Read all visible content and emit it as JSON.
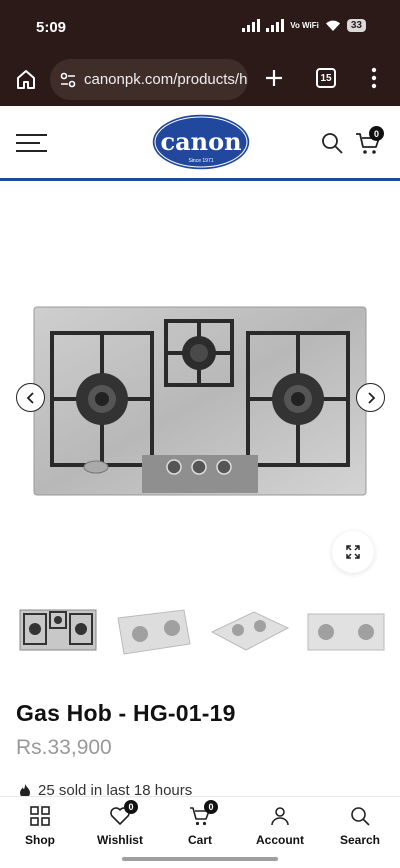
{
  "status_bar": {
    "time": "5:09",
    "network": "Vo WiFi",
    "battery": "33"
  },
  "browser": {
    "url": "canonpk.com/products/h",
    "tab_count": "15"
  },
  "header": {
    "logo_text": "canon",
    "logo_sub": "Since 1971",
    "cart_count": "0",
    "brand_color": "#21489d"
  },
  "product": {
    "title": "Gas Hob - HG-01-19",
    "price": "Rs.33,900",
    "sold_info": "25 sold in last 18 hours",
    "thumbnail_count": 4
  },
  "bottom_nav": {
    "items": [
      {
        "label": "Shop",
        "icon": "grid-icon"
      },
      {
        "label": "Wishlist",
        "icon": "heart-icon",
        "badge": "0"
      },
      {
        "label": "Cart",
        "icon": "cart-icon",
        "badge": "0"
      },
      {
        "label": "Account",
        "icon": "user-icon"
      },
      {
        "label": "Search",
        "icon": "search-icon"
      }
    ]
  }
}
